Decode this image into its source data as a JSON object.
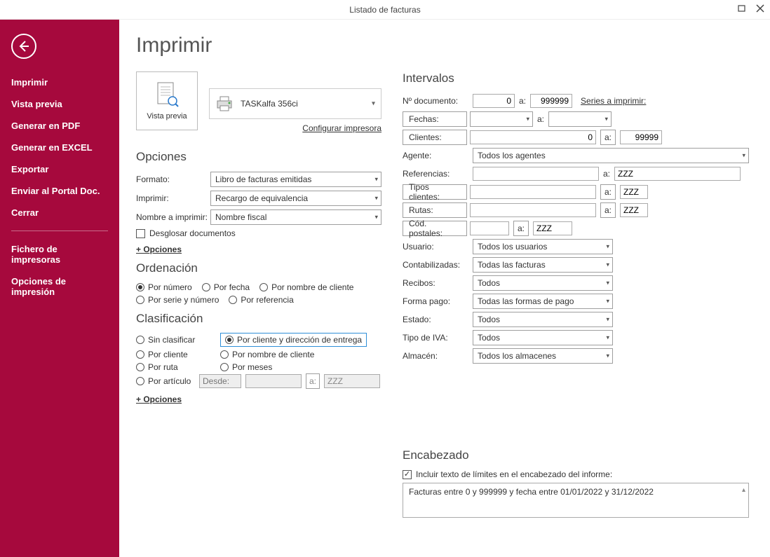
{
  "window": {
    "title": "Listado de facturas"
  },
  "sidebar": {
    "items": [
      {
        "label": "Imprimir"
      },
      {
        "label": "Vista previa"
      },
      {
        "label": "Generar en PDF"
      },
      {
        "label": "Generar en EXCEL"
      },
      {
        "label": "Exportar"
      },
      {
        "label": "Enviar al Portal Doc."
      },
      {
        "label": "Cerrar"
      }
    ],
    "items2": [
      {
        "label": "Fichero de impresoras"
      },
      {
        "label": "Opciones de impresión"
      }
    ]
  },
  "page": {
    "title": "Imprimir"
  },
  "preview": {
    "label": "Vista previa"
  },
  "printer": {
    "name": "TASKalfa 356ci",
    "config_link": "Configurar impresora"
  },
  "opciones": {
    "heading": "Opciones",
    "formato_label": "Formato:",
    "formato_value": "Libro de facturas emitidas",
    "imprimir_label": "Imprimir:",
    "imprimir_value": "Recargo de equivalencia",
    "nombre_label": "Nombre a imprimir:",
    "nombre_value": "Nombre fiscal",
    "desglosar_label": "Desglosar documentos",
    "mas_opciones": "+ Opciones"
  },
  "ordenacion": {
    "heading": "Ordenación",
    "options": [
      {
        "label": "Por número",
        "selected": true
      },
      {
        "label": "Por fecha"
      },
      {
        "label": "Por nombre de cliente"
      },
      {
        "label": "Por serie y número"
      },
      {
        "label": "Por referencia"
      }
    ]
  },
  "clasificacion": {
    "heading": "Clasificación",
    "sin": "Sin clasificar",
    "cliente_dir": "Por cliente y dirección de entrega",
    "cliente": "Por cliente",
    "nombre": "Por nombre de cliente",
    "ruta": "Por ruta",
    "meses": "Por meses",
    "articulo": "Por artículo",
    "desde": "Desde:",
    "a": "a:",
    "zzz": "ZZZ",
    "mas_opciones": "+ Opciones"
  },
  "intervalos": {
    "heading": "Intervalos",
    "ndoc_label": "Nº documento:",
    "ndoc_from": "0",
    "a": "a:",
    "ndoc_to": "999999",
    "series_link": "Series a imprimir:",
    "fechas_btn": "Fechas:",
    "clientes_btn": "Clientes:",
    "clientes_from": "0",
    "clientes_to": "99999",
    "agente_label": "Agente:",
    "agente_value": "Todos los agentes",
    "ref_label": "Referencias:",
    "ref_to": "ZZZ",
    "tipos_btn": "Tipos clientes:",
    "tipos_to": "ZZZ",
    "rutas_btn": "Rutas:",
    "rutas_to": "ZZZ",
    "cod_btn": "Cód. postales:",
    "cod_to": "ZZZ",
    "usuario_label": "Usuario:",
    "usuario_value": "Todos los usuarios",
    "contab_label": "Contabilizadas:",
    "contab_value": "Todas las facturas",
    "recibos_label": "Recibos:",
    "recibos_value": "Todos",
    "forma_label": "Forma pago:",
    "forma_value": "Todas las formas de pago",
    "estado_label": "Estado:",
    "estado_value": "Todos",
    "iva_label": "Tipo de IVA:",
    "iva_value": "Todos",
    "almacen_label": "Almacén:",
    "almacen_value": "Todos los almacenes"
  },
  "encabezado": {
    "heading": "Encabezado",
    "chk_label": "Incluir texto de límites en el encabezado del informe:",
    "text": "Facturas entre 0 y 999999 y fecha entre 01/01/2022 y 31/12/2022"
  }
}
